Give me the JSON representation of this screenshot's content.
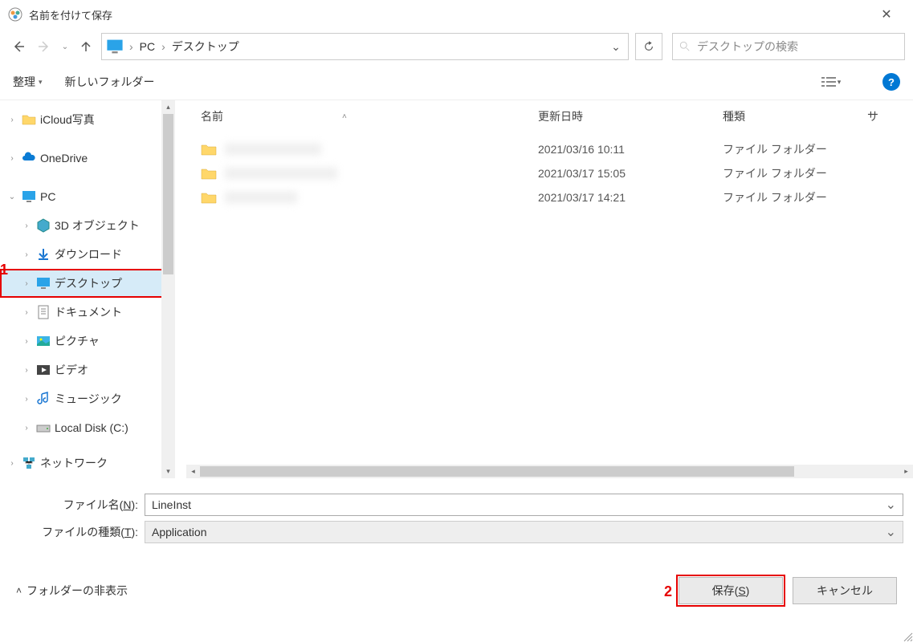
{
  "window": {
    "title": "名前を付けて保存",
    "close_label": "✕"
  },
  "nav": {
    "back": "←",
    "forward": "→",
    "recent": "⌄",
    "up": "↑",
    "refresh": "⟳"
  },
  "breadcrumb": {
    "seg1": "PC",
    "seg2": "デスクトップ",
    "sep": "›",
    "drop": "⌄"
  },
  "search": {
    "placeholder": "デスクトップの検索"
  },
  "toolbar": {
    "organize": "整理",
    "new_folder": "新しいフォルダー",
    "help": "?"
  },
  "columns": {
    "name": "名前",
    "date": "更新日時",
    "type": "種類",
    "size": "サ"
  },
  "files": [
    {
      "date": "2021/03/16 10:11",
      "type": "ファイル フォルダー"
    },
    {
      "date": "2021/03/17 15:05",
      "type": "ファイル フォルダー"
    },
    {
      "date": "2021/03/17 14:21",
      "type": "ファイル フォルダー"
    }
  ],
  "tree": {
    "icloud": "iCloud写真",
    "onedrive": "OneDrive",
    "pc": "PC",
    "obj3d": "3D オブジェクト",
    "downloads": "ダウンロード",
    "desktop": "デスクトップ",
    "documents": "ドキュメント",
    "pictures": "ピクチャ",
    "videos": "ビデオ",
    "music": "ミュージック",
    "localdisk": "Local Disk (C:)",
    "network": "ネットワーク"
  },
  "form": {
    "filename_label": "ファイル名(",
    "filename_key": "N",
    "filename_label2": "):",
    "filename_value": "LineInst",
    "filetype_label": "ファイルの種類(",
    "filetype_key": "T",
    "filetype_label2": "):",
    "filetype_value": "Application"
  },
  "footer": {
    "hide_folders": "フォルダーの非表示",
    "save": "保存(",
    "save_key": "S",
    "save2": ")",
    "cancel": "キャンセル"
  },
  "annot": {
    "one": "1",
    "two": "2"
  }
}
